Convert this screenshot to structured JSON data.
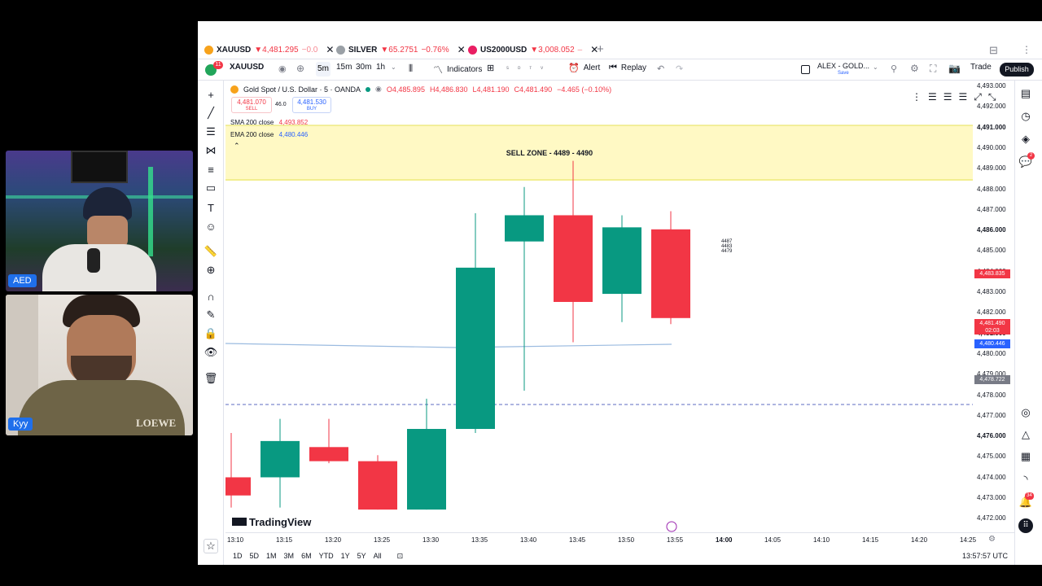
{
  "tabs": [
    {
      "symbol": "XAUUSD",
      "price": "▼4,481.295",
      "change": "−0.0",
      "color": "#f7a21b"
    },
    {
      "symbol": "SILVER",
      "price": "▼65.2751",
      "change": "−0.76%",
      "color": "#9aa0a6"
    },
    {
      "symbol": "US2000USD",
      "price": "▼3,008.052",
      "change": "–",
      "color": "#e91e63"
    }
  ],
  "toolbar": {
    "symbol": "XAUUSD",
    "intervals": [
      "5m",
      "15m",
      "30m",
      "1h"
    ],
    "indicators": "Indicators",
    "alert": "Alert",
    "replay": "Replay",
    "layout_name": "ALEX - GOLD...",
    "layout_sub": "Save",
    "trade": "Trade",
    "publish": "Publish",
    "notif_count": "11"
  },
  "legend": {
    "title": "Gold Spot / U.S. Dollar · 5 · OANDA",
    "ohlc_o": "O4,485.895",
    "ohlc_h": "H4,486.830",
    "ohlc_l": "L4,481.190",
    "ohlc_c": "C4,481.490",
    "ohlc_chg": "−4.465 (−0.10%)",
    "sell_price": "4,481.070",
    "sell_label": "SELL",
    "spread": "46.0",
    "buy_price": "4,481.530",
    "buy_label": "BUY",
    "sma_label": "SMA 200 close",
    "sma_value": "4,493.852",
    "ema_label": "EMA 200 close",
    "ema_value": "4,480.446"
  },
  "annotations": {
    "sell_zone": "SELL ZONE - 4489 - 4490",
    "note_lines": [
      "4487",
      "4483",
      "4479"
    ],
    "watermark": "TradingView"
  },
  "price_axis": {
    "labels": [
      "4,493.000",
      "4,492.000",
      "4,491.000",
      "4,490.000",
      "4,489.000",
      "4,488.000",
      "4,487.000",
      "4,486.000",
      "4,485.000",
      "4,484.000",
      "4,483.000",
      "4,482.000",
      "4,481.000",
      "4,480.000",
      "4,479.000",
      "4,478.000",
      "4,477.000",
      "4,476.000",
      "4,475.000",
      "4,474.000",
      "4,473.000",
      "4,472.000"
    ],
    "tag_red_1": "4,483.835",
    "tag_red_2": "4,481.490",
    "tag_red_2_sub": "02:03",
    "tag_blue": "4,480.446",
    "tag_gray": "4,478.722"
  },
  "time_axis": {
    "labels": [
      "13:10",
      "13:15",
      "13:20",
      "13:25",
      "13:30",
      "13:35",
      "13:40",
      "13:45",
      "13:50",
      "13:55",
      "14:00",
      "14:05",
      "14:10",
      "14:15",
      "14:20",
      "14:25"
    ],
    "clock": "13:57:57 UTC"
  },
  "ranges": [
    "1D",
    "5D",
    "1M",
    "3M",
    "6M",
    "YTD",
    "1Y",
    "5Y",
    "All"
  ],
  "participants": [
    {
      "name": "AED"
    },
    {
      "name": "Kyy"
    }
  ],
  "colors": {
    "up": "#089981",
    "down": "#f23645",
    "zone": "#fff9c4",
    "sma": "#9bbbe0"
  },
  "chart_data": {
    "type": "candlestick",
    "x": [
      "13:10",
      "13:15",
      "13:20",
      "13:25",
      "13:30",
      "13:35",
      "13:40",
      "13:45",
      "13:50",
      "13:55"
    ],
    "open": [
      4473.6,
      4473.6,
      4475.1,
      4474.4,
      4472.0,
      4476.0,
      4485.3,
      4486.6,
      4482.7,
      4485.9
    ],
    "high": [
      4475.8,
      4476.5,
      4476.5,
      4474.7,
      4477.5,
      4486.7,
      4488.0,
      4489.3,
      4486.6,
      4486.8
    ],
    "low": [
      4472.1,
      4472.1,
      4474.3,
      4472.0,
      4472.0,
      4475.8,
      4477.9,
      4480.3,
      4481.3,
      4481.2
    ],
    "close": [
      4472.7,
      4475.4,
      4474.4,
      4472.0,
      4476.0,
      4484.0,
      4486.6,
      4482.3,
      4486.0,
      4481.5
    ],
    "ylim": [
      4471.6,
      4493.2
    ]
  }
}
